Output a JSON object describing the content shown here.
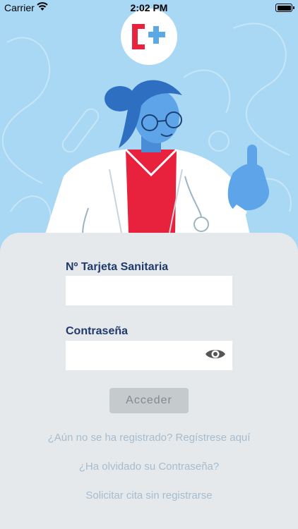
{
  "status_bar": {
    "carrier": "Carrier",
    "time": "2:02 PM"
  },
  "login": {
    "card_label": "Nº Tarjeta Sanitaria",
    "card_value": "",
    "password_label": "Contraseña",
    "password_value": "",
    "submit_label": "Acceder"
  },
  "links": {
    "register": "¿Aún no se ha registrado? Regístrese aquí",
    "forgot": "¿Ha olvidado su Contraseña?",
    "appointment": "Solicitar cita sin registrarse"
  },
  "colors": {
    "background": "#a9d8f4",
    "panel": "#e5e9ec",
    "label": "#1f3a6b",
    "link": "#a6bccd",
    "brand_red": "#e8223c",
    "brand_blue": "#5aa8e6"
  },
  "icons": {
    "logo": "health-cross-logo",
    "wifi": "wifi-icon",
    "battery": "battery-icon",
    "password_toggle": "eye-icon"
  }
}
